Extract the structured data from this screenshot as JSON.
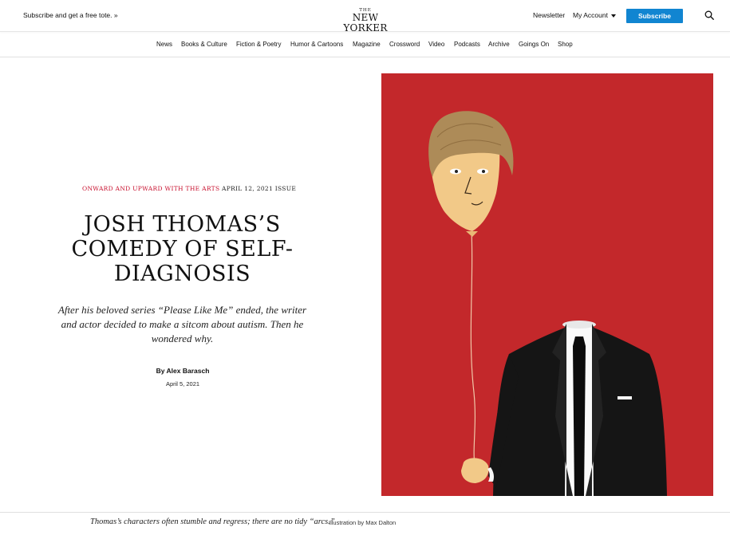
{
  "header": {
    "promo": "Subscribe and get a free tote. »",
    "logo_the": "THE",
    "logo_name": "NEW YORKER",
    "newsletter": "Newsletter",
    "account": "My Account",
    "subscribe": "Subscribe",
    "search_icon": "search-icon"
  },
  "nav": {
    "items": [
      "News",
      "Books & Culture",
      "Fiction & Poetry",
      "Humor & Cartoons",
      "Magazine",
      "Crossword",
      "Video",
      "Podcasts",
      "Archive",
      "Goings On",
      "Shop"
    ]
  },
  "article": {
    "rubric": "ONWARD AND UPWARD WITH THE ARTS",
    "issue": "APRIL 12, 2021 ISSUE",
    "headline": "Josh Thomas’s Comedy of Self-Diagnosis",
    "dek": "After his beloved series “Please Like Me” ended, the writer and actor decided to make a sitcom about autism. Then he wondered why.",
    "byline": "By Alex Barasch",
    "date": "April 5, 2021"
  },
  "illustration": {
    "background_color": "#c3282b",
    "caption": "Thomas’s characters often stumble and regress; there are no tidy “arcs.”",
    "credit": "Illustration by Max Dalton"
  },
  "colors": {
    "accent_blue": "#1185d1",
    "rubric_red": "#c8102e"
  }
}
